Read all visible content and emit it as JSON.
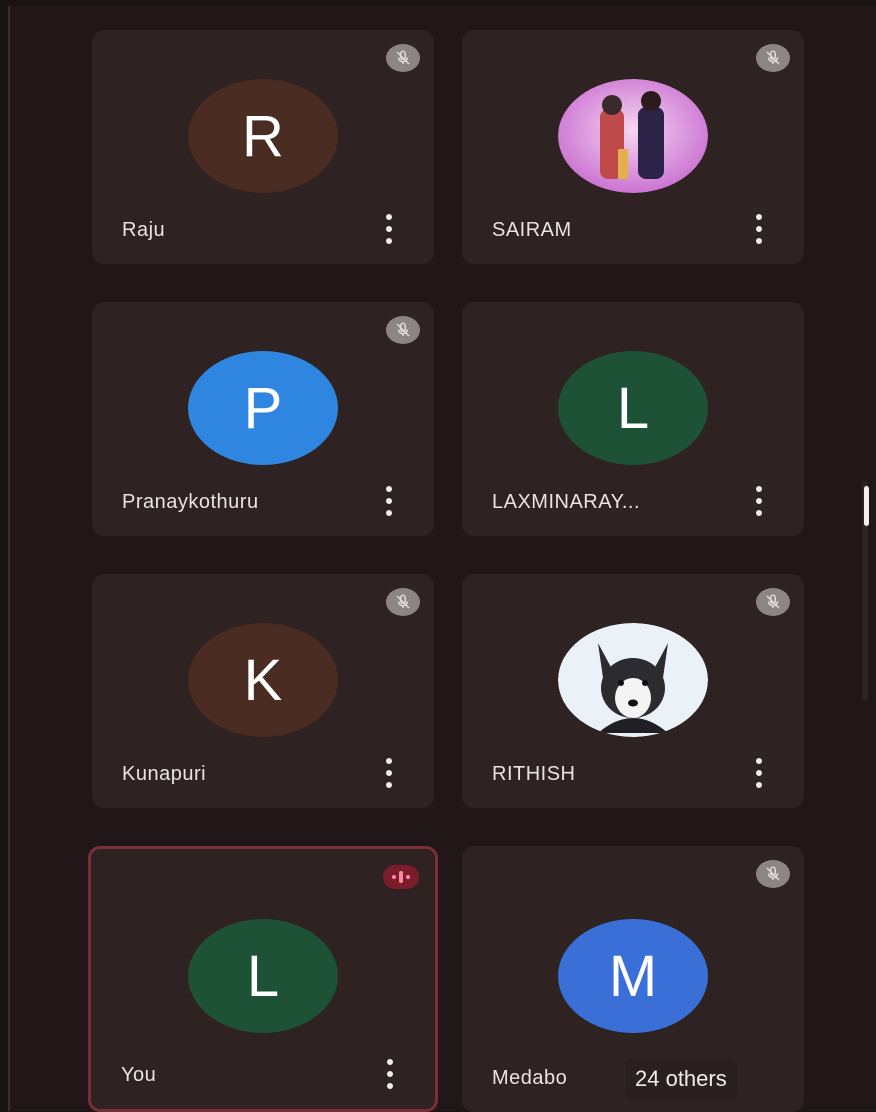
{
  "participants": [
    {
      "name": "Raju",
      "initial": "R",
      "avatar_color": "#4a2c22",
      "status": "muted"
    },
    {
      "name": "SAIRAM",
      "initial": "",
      "avatar_color": "",
      "status": "muted",
      "photo": "anime-characters"
    },
    {
      "name": "Pranaykothuru",
      "initial": "P",
      "avatar_color": "#2f86e0",
      "status": "muted"
    },
    {
      "name": "LAXMINARAY...",
      "initial": "L",
      "avatar_color": "#1e5236",
      "status": "muted"
    },
    {
      "name": "Kunapuri",
      "initial": "K",
      "avatar_color": "#4a2c22",
      "status": "muted"
    },
    {
      "name": "RITHISH",
      "initial": "",
      "avatar_color": "",
      "status": "muted",
      "photo": "husky-dog"
    },
    {
      "name": "You",
      "initial": "L",
      "avatar_color": "#1e5236",
      "status": "speaking"
    },
    {
      "name": "Medabo",
      "initial": "M",
      "avatar_color": "#3a6fd8",
      "status": "muted"
    }
  ],
  "others_label": "24 others",
  "icons": {
    "mute": "mic-off-icon",
    "more": "more-vert-icon",
    "speaking": "audio-level-icon"
  },
  "colors": {
    "background": "#221718",
    "tile": "#2e2222",
    "active_border": "#7a2f36"
  }
}
